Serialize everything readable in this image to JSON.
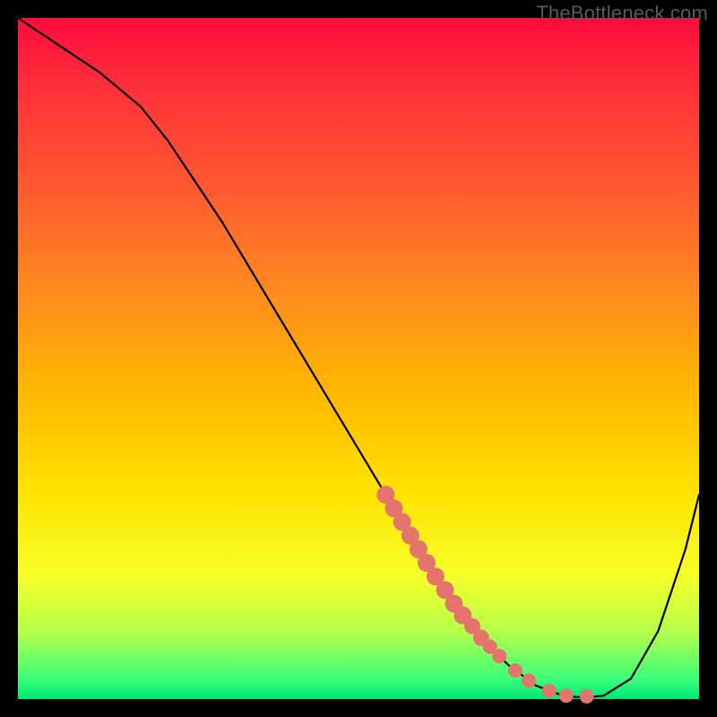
{
  "watermark": "TheBottleneck.com",
  "chart_data": {
    "type": "line",
    "title": "",
    "xlabel": "",
    "ylabel": "",
    "xlim": [
      0,
      100
    ],
    "ylim": [
      0,
      100
    ],
    "grid": false,
    "legend": false,
    "series": [
      {
        "name": "curve",
        "color": "#000000",
        "x": [
          0,
          6,
          12,
          18,
          22,
          26,
          30,
          36,
          42,
          48,
          54,
          60,
          64,
          68,
          72,
          76,
          80,
          82,
          84,
          86,
          90,
          94,
          98,
          100
        ],
        "y": [
          100,
          96,
          92,
          87,
          82,
          76,
          70,
          60,
          50,
          40,
          30,
          20,
          14,
          9,
          5,
          2,
          0.5,
          0.3,
          0.3,
          0.5,
          3,
          10,
          22,
          30
        ]
      }
    ],
    "markers": {
      "name": "highlight-dots",
      "color": "#e4746c",
      "radius_large": 10,
      "radius_small": 8,
      "points": [
        {
          "x": 54.0,
          "y": 30.0,
          "r": 10
        },
        {
          "x": 55.2,
          "y": 28.0,
          "r": 10
        },
        {
          "x": 56.4,
          "y": 26.0,
          "r": 10
        },
        {
          "x": 57.6,
          "y": 24.0,
          "r": 10
        },
        {
          "x": 58.8,
          "y": 22.0,
          "r": 10
        },
        {
          "x": 60.0,
          "y": 20.0,
          "r": 10
        },
        {
          "x": 61.3,
          "y": 18.0,
          "r": 10
        },
        {
          "x": 62.7,
          "y": 16.0,
          "r": 10
        },
        {
          "x": 64.0,
          "y": 14.0,
          "r": 10
        },
        {
          "x": 65.3,
          "y": 12.3,
          "r": 10
        },
        {
          "x": 66.7,
          "y": 10.7,
          "r": 9
        },
        {
          "x": 68.0,
          "y": 9.0,
          "r": 9
        },
        {
          "x": 69.3,
          "y": 7.7,
          "r": 8
        },
        {
          "x": 70.7,
          "y": 6.3,
          "r": 8
        },
        {
          "x": 73.0,
          "y": 4.2,
          "r": 8
        },
        {
          "x": 75.0,
          "y": 2.7,
          "r": 8
        },
        {
          "x": 78.0,
          "y": 1.2,
          "r": 8
        },
        {
          "x": 80.5,
          "y": 0.5,
          "r": 8
        },
        {
          "x": 83.5,
          "y": 0.4,
          "r": 8
        }
      ]
    }
  }
}
